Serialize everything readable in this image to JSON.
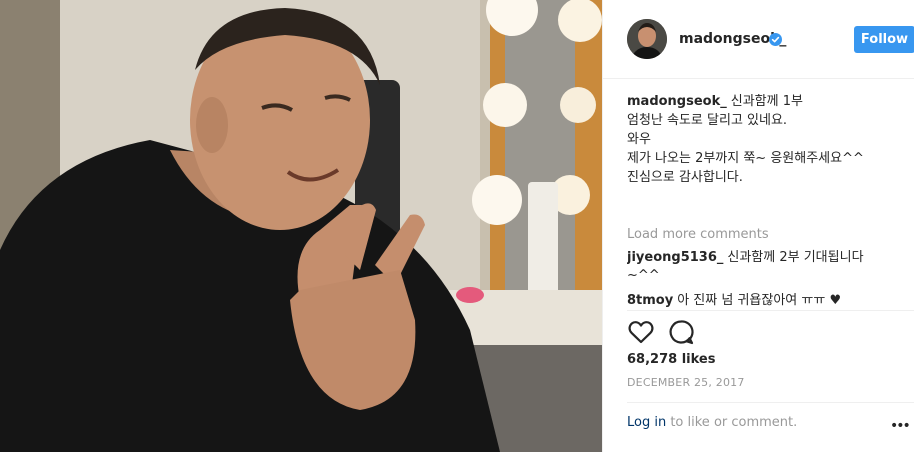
{
  "post": {
    "username": "madongseok_",
    "follow_label": "Follow",
    "caption": {
      "user": "madongseok_",
      "lines": [
        "신과함께 1부",
        "엄청난 속도로 달리고 있네요.",
        "와우",
        "",
        "제가 나오는 2부까지 쭉~ 응원해주세요^^",
        "",
        "진심으로 감사합니다."
      ]
    },
    "load_more_label": "Load more comments",
    "comments": [
      {
        "user": "jiyeong5136_",
        "text": "신과함께 2부 기대됩니다",
        "text2": "~^^"
      },
      {
        "user": "8tmoy",
        "text": "아 진짜 넘 귀욥잖아여 ㅠㅠ ♥"
      }
    ],
    "likes": "68,278 likes",
    "date": "DECEMBER 25, 2017",
    "login_link": "Log in",
    "login_rest": " to like or comment.",
    "more_label": "•••"
  },
  "colors": {
    "follow_button": "#3897f0",
    "verified_badge": "#3897f0",
    "link": "#003569",
    "muted": "#999999"
  },
  "icons": {
    "verified": "verified-badge-icon",
    "like": "heart-icon",
    "comment": "comment-bubble-icon",
    "more": "more-options-icon"
  }
}
